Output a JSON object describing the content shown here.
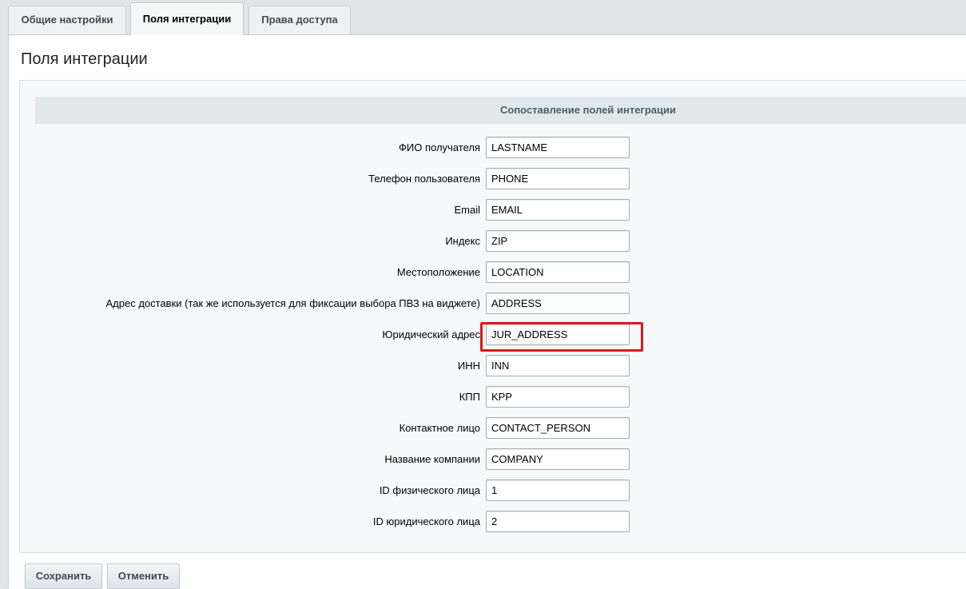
{
  "tabs": [
    {
      "label": "Общие настройки"
    },
    {
      "label": "Поля интеграции"
    },
    {
      "label": "Права доступа"
    }
  ],
  "page_title": "Поля интеграции",
  "section_title": "Сопоставление полей интеграции",
  "fields": [
    {
      "label": "ФИО получателя",
      "value": "LASTNAME"
    },
    {
      "label": "Телефон пользователя",
      "value": "PHONE"
    },
    {
      "label": "Email",
      "value": "EMAIL"
    },
    {
      "label": "Индекс",
      "value": "ZIP"
    },
    {
      "label": "Местоположение",
      "value": "LOCATION"
    },
    {
      "label": "Адрес доставки (так же используется для фиксации выбора ПВЗ на виджете)",
      "value": "ADDRESS"
    },
    {
      "label": "Юридический адрес",
      "value": "JUR_ADDRESS"
    },
    {
      "label": "ИНН",
      "value": "INN"
    },
    {
      "label": "КПП",
      "value": "KPP"
    },
    {
      "label": "Контактное лицо",
      "value": "CONTACT_PERSON"
    },
    {
      "label": "Название компании",
      "value": "COMPANY"
    },
    {
      "label": "ID физического лица",
      "value": "1"
    },
    {
      "label": "ID юридического лица",
      "value": "2"
    }
  ],
  "buttons": {
    "save": "Сохранить",
    "cancel": "Отменить"
  },
  "colors": {
    "highlight": "#e0161b"
  }
}
